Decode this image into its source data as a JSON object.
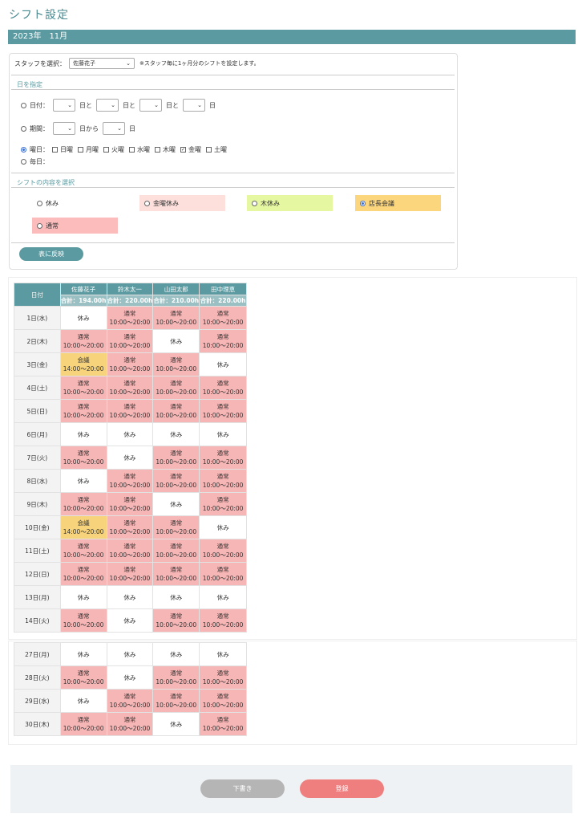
{
  "page_title": "シフト設定",
  "month": "2023年　11月",
  "staff_select": {
    "label": "スタッフを選択：",
    "value": "佐藤花子",
    "note": "※スタッフ毎に1ヶ月分のシフトを設定します。"
  },
  "date_section": {
    "label": "日を指定",
    "date_label": "日付：",
    "day_to": "日と",
    "day": "日",
    "period_label": "期間：",
    "day_from": "日から",
    "weekday_label": "曜日：",
    "weekdays": [
      "日曜",
      "月曜",
      "火曜",
      "水曜",
      "木曜",
      "金曜",
      "土曜"
    ],
    "daily_label": "毎日："
  },
  "shift_section": {
    "label": "シフトの内容を選択",
    "options": [
      "休み",
      "金曜休み",
      "木休み",
      "店長会議",
      "通常"
    ]
  },
  "apply_button": "表に反映",
  "table": {
    "date_header": "日付",
    "staff": [
      "佐藤花子",
      "鈴木太一",
      "山田太郎",
      "田中理恵"
    ],
    "totals": [
      "合計：194.00h",
      "合計：220.00h",
      "合計：210.00h",
      "合計：220.00h"
    ],
    "rows1": [
      {
        "d": "1日(水)",
        "c": [
          [
            "休み",
            ""
          ],
          [
            "通常",
            "10:00〜20:00"
          ],
          [
            "通常",
            "10:00〜20:00"
          ],
          [
            "通常",
            "10:00〜20:00"
          ]
        ]
      },
      {
        "d": "2日(木)",
        "c": [
          [
            "通常",
            "10:00〜20:00"
          ],
          [
            "通常",
            "10:00〜20:00"
          ],
          [
            "休み",
            ""
          ],
          [
            "通常",
            "10:00〜20:00"
          ]
        ]
      },
      {
        "d": "3日(金)",
        "c": [
          [
            "会議",
            "14:00〜20:00"
          ],
          [
            "通常",
            "10:00〜20:00"
          ],
          [
            "通常",
            "10:00〜20:00"
          ],
          [
            "休み",
            ""
          ]
        ]
      },
      {
        "d": "4日(土)",
        "c": [
          [
            "通常",
            "10:00〜20:00"
          ],
          [
            "通常",
            "10:00〜20:00"
          ],
          [
            "通常",
            "10:00〜20:00"
          ],
          [
            "通常",
            "10:00〜20:00"
          ]
        ]
      },
      {
        "d": "5日(日)",
        "c": [
          [
            "通常",
            "10:00〜20:00"
          ],
          [
            "通常",
            "10:00〜20:00"
          ],
          [
            "通常",
            "10:00〜20:00"
          ],
          [
            "通常",
            "10:00〜20:00"
          ]
        ]
      },
      {
        "d": "6日(月)",
        "c": [
          [
            "休み",
            ""
          ],
          [
            "休み",
            ""
          ],
          [
            "休み",
            ""
          ],
          [
            "休み",
            ""
          ]
        ]
      },
      {
        "d": "7日(火)",
        "c": [
          [
            "通常",
            "10:00〜20:00"
          ],
          [
            "休み",
            ""
          ],
          [
            "通常",
            "10:00〜20:00"
          ],
          [
            "通常",
            "10:00〜20:00"
          ]
        ]
      },
      {
        "d": "8日(水)",
        "c": [
          [
            "休み",
            ""
          ],
          [
            "通常",
            "10:00〜20:00"
          ],
          [
            "通常",
            "10:00〜20:00"
          ],
          [
            "通常",
            "10:00〜20:00"
          ]
        ]
      },
      {
        "d": "9日(木)",
        "c": [
          [
            "通常",
            "10:00〜20:00"
          ],
          [
            "通常",
            "10:00〜20:00"
          ],
          [
            "休み",
            ""
          ],
          [
            "通常",
            "10:00〜20:00"
          ]
        ]
      },
      {
        "d": "10日(金)",
        "c": [
          [
            "会議",
            "14:00〜20:00"
          ],
          [
            "通常",
            "10:00〜20:00"
          ],
          [
            "通常",
            "10:00〜20:00"
          ],
          [
            "休み",
            ""
          ]
        ]
      },
      {
        "d": "11日(土)",
        "c": [
          [
            "通常",
            "10:00〜20:00"
          ],
          [
            "通常",
            "10:00〜20:00"
          ],
          [
            "通常",
            "10:00〜20:00"
          ],
          [
            "通常",
            "10:00〜20:00"
          ]
        ]
      },
      {
        "d": "12日(日)",
        "c": [
          [
            "通常",
            "10:00〜20:00"
          ],
          [
            "通常",
            "10:00〜20:00"
          ],
          [
            "通常",
            "10:00〜20:00"
          ],
          [
            "通常",
            "10:00〜20:00"
          ]
        ]
      },
      {
        "d": "13日(月)",
        "c": [
          [
            "休み",
            ""
          ],
          [
            "休み",
            ""
          ],
          [
            "休み",
            ""
          ],
          [
            "休み",
            ""
          ]
        ]
      },
      {
        "d": "14日(火)",
        "c": [
          [
            "通常",
            "10:00〜20:00"
          ],
          [
            "休み",
            ""
          ],
          [
            "通常",
            "10:00〜20:00"
          ],
          [
            "通常",
            "10:00〜20:00"
          ]
        ]
      }
    ],
    "rows2": [
      {
        "d": "27日(月)",
        "c": [
          [
            "休み",
            ""
          ],
          [
            "休み",
            ""
          ],
          [
            "休み",
            ""
          ],
          [
            "休み",
            ""
          ]
        ]
      },
      {
        "d": "28日(火)",
        "c": [
          [
            "通常",
            "10:00〜20:00"
          ],
          [
            "休み",
            ""
          ],
          [
            "通常",
            "10:00〜20:00"
          ],
          [
            "通常",
            "10:00〜20:00"
          ]
        ]
      },
      {
        "d": "29日(水)",
        "c": [
          [
            "休み",
            ""
          ],
          [
            "通常",
            "10:00〜20:00"
          ],
          [
            "通常",
            "10:00〜20:00"
          ],
          [
            "通常",
            "10:00〜20:00"
          ]
        ]
      },
      {
        "d": "30日(木)",
        "c": [
          [
            "通常",
            "10:00〜20:00"
          ],
          [
            "通常",
            "10:00〜20:00"
          ],
          [
            "休み",
            ""
          ],
          [
            "通常",
            "10:00〜20:00"
          ]
        ]
      }
    ]
  },
  "footer": {
    "draft_button": "下書き",
    "submit_button": "登録"
  }
}
